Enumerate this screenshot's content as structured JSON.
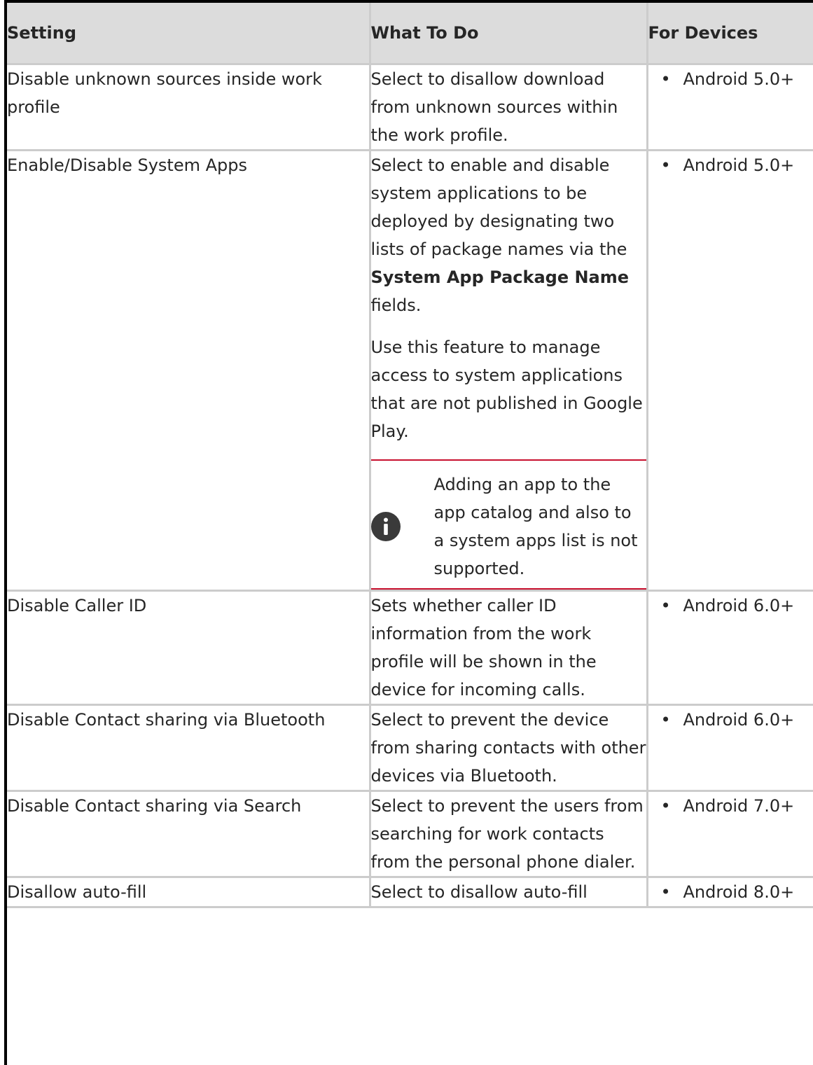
{
  "table": {
    "headers": {
      "setting": "Setting",
      "what_to_do": "What To Do",
      "for_devices": "For Devices"
    },
    "rows": [
      {
        "setting": "Disable unknown sources inside work profile",
        "what_to_do": "Select to disallow download from unknown sources within the work profile.",
        "devices": [
          "Android 5.0+"
        ]
      },
      {
        "setting": "Enable/Disable System Apps",
        "what_to_do_part1": "Select to enable and disable system applications to be deployed by designating two lists of package names via the",
        "what_to_do_bold": "System App Package Name",
        "what_to_do_part2": "fields.",
        "what_to_do_para2": "Use this feature to manage access to system applications that are not published in Google Play.",
        "note": "Adding an app to the app catalog and also to a system apps list is not supported.",
        "note_icon": "info-icon",
        "devices": [
          "Android 5.0+"
        ]
      },
      {
        "setting": "Disable Caller ID",
        "what_to_do": "Sets whether caller ID information from the work profile will be shown in the device for incoming calls.",
        "devices": [
          "Android 6.0+"
        ]
      },
      {
        "setting": "Disable Contact sharing via Bluetooth",
        "what_to_do": "Select to prevent the device from sharing contacts with other devices via Bluetooth.",
        "devices": [
          "Android 6.0+"
        ]
      },
      {
        "setting": "Disable Contact sharing via Search",
        "what_to_do": "Select to prevent the users from searching for work contacts from the personal phone dialer.",
        "devices": [
          "Android 7.0+"
        ]
      },
      {
        "setting": "Disallow auto-fill",
        "what_to_do": "Select to disallow auto-fill",
        "devices": [
          "Android 8.0+"
        ]
      }
    ]
  },
  "colors": {
    "header_bg": "#dcdcdc",
    "border": "#cccccc",
    "note_rule": "#c8102e",
    "text": "#262626"
  }
}
